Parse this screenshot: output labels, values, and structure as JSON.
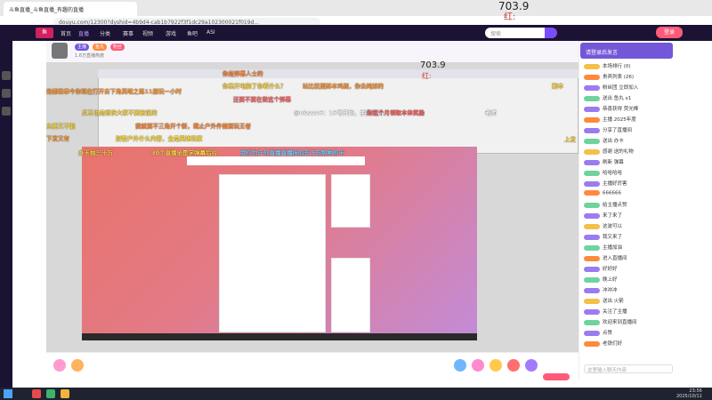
{
  "browser": {
    "tab_title": "斗鱼直播_斗鱼直播_有趣的直播",
    "url": "douyu.com/12300?dyshid=4b9d4-cab1b7922f3f1dc29a102300021f019d..."
  },
  "overlay": {
    "count": "703.9",
    "sub": "红:"
  },
  "overlay2": {
    "count": "703.9",
    "sub": "红:"
  },
  "site": {
    "nav": [
      "首页",
      "直播",
      "分类",
      "赛事",
      "视频",
      "游戏",
      "鱼吧",
      "ASI"
    ],
    "search_placeholder": "搜索",
    "login": "登录"
  },
  "room": {
    "tags": [
      "主播",
      "鱼丸",
      "粉丝"
    ],
    "title": "1.6万直播热度"
  },
  "danmaku": [
    {
      "text": "你是弹幕人士的",
      "color": "#ff8a3d"
    },
    {
      "text": "你离开电脑了你看什么？",
      "color": "#ffd84a"
    },
    {
      "text": "站比抚提酥本鸡剧，你去纯掉的",
      "color": "#ff9b3d"
    },
    {
      "text": "还要不要在做这个弹幕",
      "color": "#ff6b6b"
    },
    {
      "text": "@nizzzz6：15号开始，抽奖开始",
      "color": "#ffffff"
    },
    {
      "text": "他都做事今你现在打开去下角英魂之路11服玩一小时",
      "color": "#ff9d3d"
    },
    {
      "text": "你这个月领取本体奖励",
      "color": "#ff6363"
    },
    {
      "text": "反正也是很快大家不要被低的",
      "color": "#ffd84a"
    },
    {
      "text": "主要又不能",
      "color": "#ffdf3d"
    },
    {
      "text": "我就要不三角开个新，截止户外件需要玩王者",
      "color": "#ff8c3d"
    },
    {
      "text": "下发又有",
      "color": "#ff9d3d"
    },
    {
      "text": "别管户外什么内容，全是英雄玩家",
      "color": "#ffe03d"
    },
    {
      "text": "办卡抽三十万",
      "color": "#ffd84a"
    },
    {
      "text": "30个直播全是学弹幕后台",
      "color": "#ffd84a"
    },
    {
      "text": "我们为户外直播直播挂的去下方那种的卡",
      "color": "#7fd0ff"
    },
    {
      "text": "剩本",
      "color": "#ffd84a"
    },
    {
      "text": "上发",
      "color": "#ffd84a"
    },
    {
      "text": "老师",
      "color": "#ffffff"
    }
  ],
  "right": {
    "header": "请登录后发言",
    "items": [
      "本场排行 (0)",
      "贵宾列表 (26)",
      "粉丝团 立即加入",
      "送出 鱼丸 x1",
      "恭喜获得 荧光棒",
      "主播 2025年度",
      "分享了直播间",
      "送出 办卡",
      "感谢 送的礼物",
      "刷新 弹幕",
      "哈哈哈哈",
      "主播好厉害",
      "666666",
      "给主播点赞",
      "来了来了",
      "这波可以",
      "我又来了",
      "主播加油",
      "进入直播间",
      "好好好",
      "晚上好",
      "冲冲冲",
      "送出 火箭",
      "关注了主播",
      "欢迎来到直播间",
      "点赞",
      "老铁们好"
    ],
    "chat_placeholder": "这里输入聊天内容"
  },
  "clock": {
    "time": "23:56",
    "date": "2025/10/11"
  },
  "colors": {
    "accent": "#7457d8",
    "site": "#1c1233",
    "brand": "#ff5b79"
  }
}
